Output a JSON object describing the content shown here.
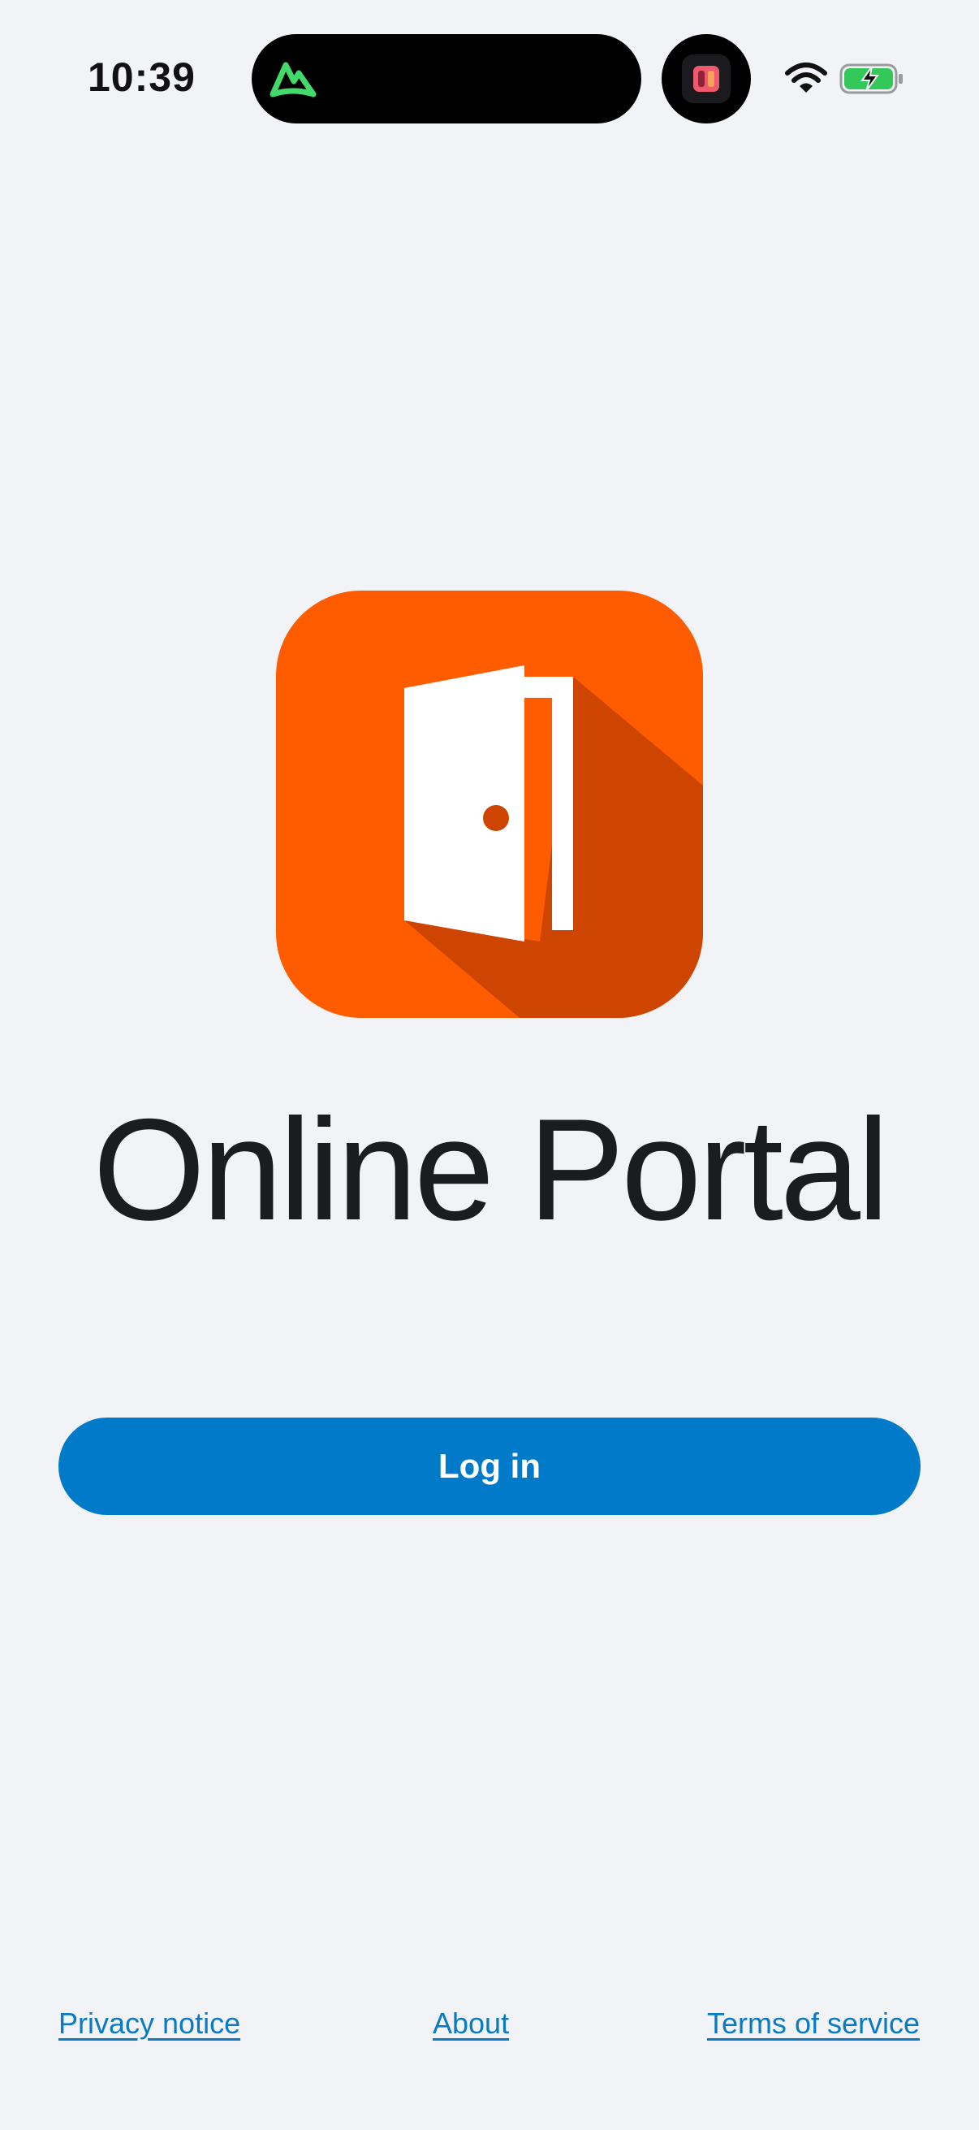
{
  "status_bar": {
    "time": "10:39",
    "icons": [
      "mountain-app-icon",
      "headphones-app-icon",
      "wifi-icon",
      "battery-charging-icon"
    ]
  },
  "app": {
    "icon": "open-door-icon",
    "title": "Online Portal",
    "colors": {
      "icon_background": "#ff5c00",
      "icon_shadow": "#cd4500",
      "button": "#007ac9",
      "link": "#0a7ac4",
      "background": "#f2f3f7"
    }
  },
  "actions": {
    "login_label": "Log in"
  },
  "footer": {
    "privacy_label": "Privacy notice",
    "about_label": "About",
    "terms_label": "Terms of service"
  }
}
